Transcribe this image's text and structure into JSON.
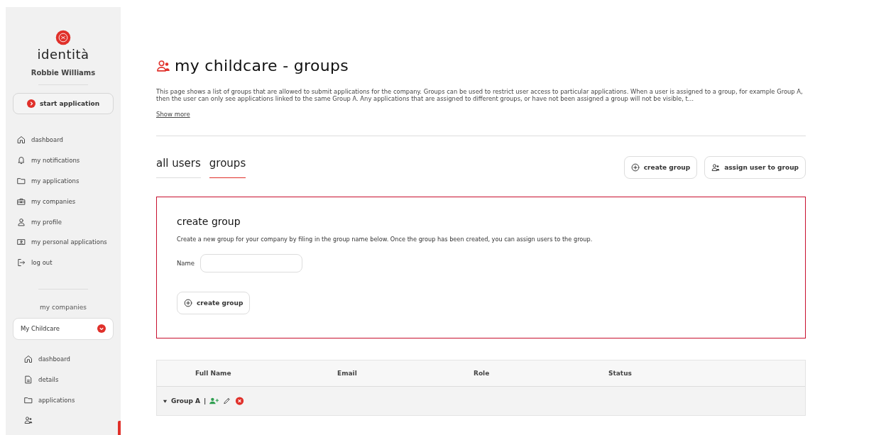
{
  "sidebar": {
    "brand": "identità",
    "user_name": "Robbie Williams",
    "start_button": "start application",
    "nav_items": [
      {
        "kind": "home",
        "label": "dashboard"
      },
      {
        "kind": "bell",
        "label": "my notifications"
      },
      {
        "kind": "folder",
        "label": "my applications"
      },
      {
        "kind": "briefcase",
        "label": "my companies"
      },
      {
        "kind": "person",
        "label": "my profile"
      },
      {
        "kind": "idcard",
        "label": "my personal applications"
      },
      {
        "kind": "logout",
        "label": "log out"
      }
    ],
    "companies_heading": "my companies",
    "company_select": {
      "value": "My Childcare"
    },
    "company_nav": [
      {
        "kind": "home",
        "label": "dashboard",
        "selected": false
      },
      {
        "kind": "document",
        "label": "details",
        "selected": false
      },
      {
        "kind": "folder",
        "label": "applications",
        "selected": false
      },
      {
        "kind": "people",
        "selected": true
      }
    ]
  },
  "page": {
    "title": "my childcare - groups",
    "description": "This page shows a list of groups that are allowed to submit applications for the company. Groups can be used to restrict user access to particular applications. When a user is assigned to a group, for example Group A, then the user can only see applications linked to the same Group A. Any applications that are assigned to different groups, or have not been assigned a group will not be visible, t…",
    "show_more": "Show more"
  },
  "tabs": [
    {
      "label": "all users",
      "selected": false
    },
    {
      "label": "groups",
      "selected": true
    }
  ],
  "actions": [
    {
      "kind": "create",
      "label": "create group"
    },
    {
      "kind": "assign",
      "label": "assign user to group"
    }
  ],
  "create_panel": {
    "title": "create group",
    "text": "Create a new group for your company by filing in the group name below. Once the group has been created, you can assign users to the group.",
    "name_label": "Name",
    "submit": "create group"
  },
  "table": {
    "columns": [
      "Full Name",
      "Email",
      "Role",
      "Status"
    ],
    "groups": [
      {
        "name": "Group A",
        "separator": "|",
        "expanded": true
      }
    ]
  }
}
